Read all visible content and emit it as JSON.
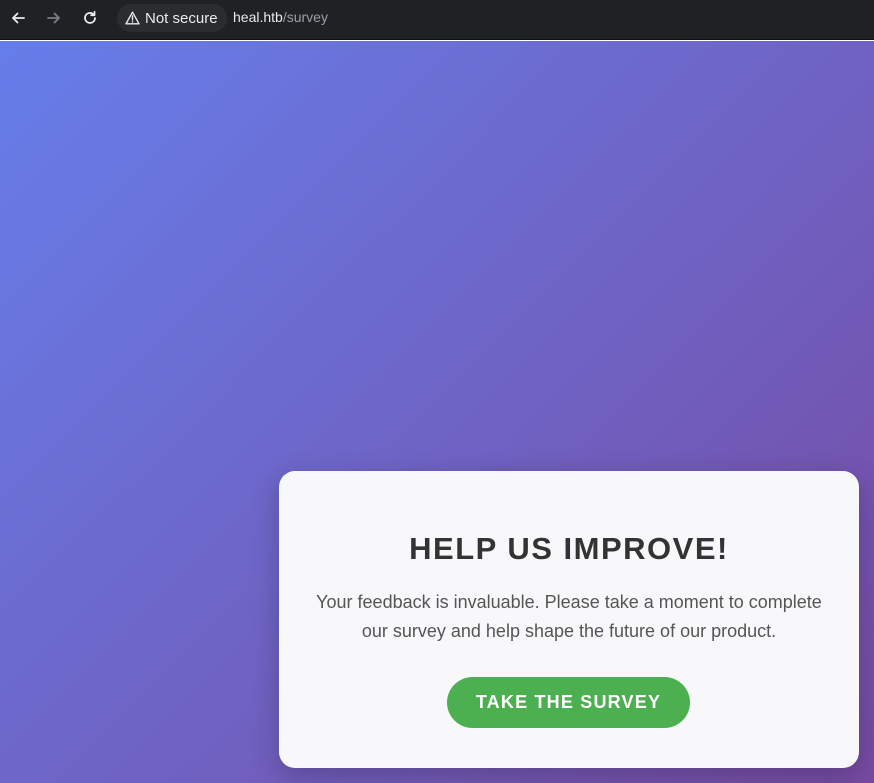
{
  "browser": {
    "back_icon": "arrow-left-icon",
    "forward_icon": "arrow-right-icon",
    "reload_icon": "reload-icon",
    "security_icon": "warning-triangle-icon",
    "security_label": "Not secure",
    "url_host": "heal.htb",
    "url_path": "/survey"
  },
  "page": {
    "background_start": "#667eea",
    "background_end": "#764ba2",
    "card": {
      "title": "HELP US IMPROVE!",
      "text": "Your feedback is invaluable. Please take a moment to complete our survey and help shape the future of our product.",
      "button_label": "TAKE THE SURVEY",
      "button_color": "#4caf50"
    }
  }
}
